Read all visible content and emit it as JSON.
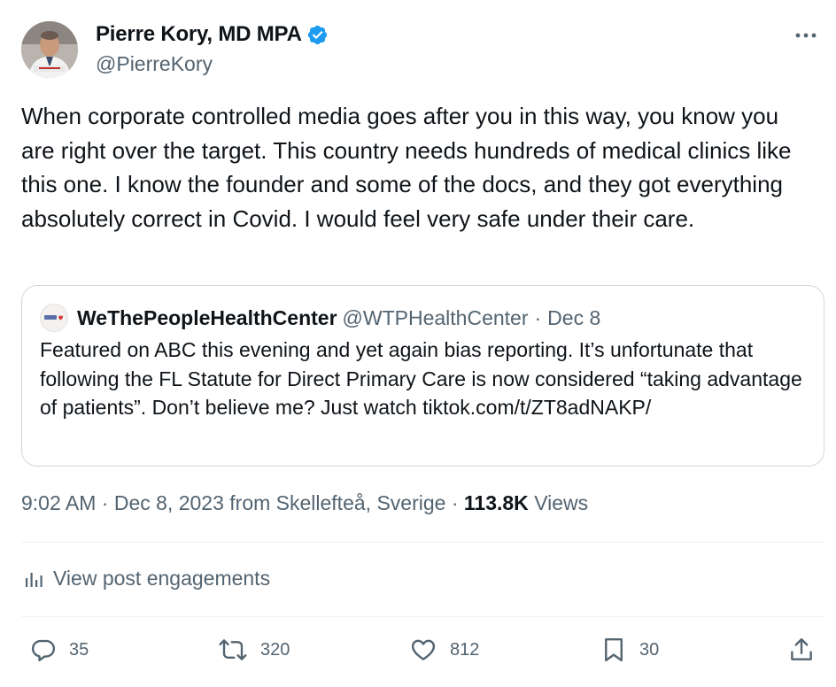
{
  "author": {
    "name": "Pierre Kory, MD MPA",
    "handle": "@PierreKory",
    "verified_color": "#1d9bf0"
  },
  "tweet": {
    "text": "When corporate controlled media goes after you in this way, you know you are right over the target. This country needs hundreds of medical clinics like this one. I know the founder and some of the docs, and they got everything absolutely correct in Covid. I would feel very safe under their care."
  },
  "quote": {
    "name": "WeThePeopleHealthCenter",
    "handle": "@WTPHealthCenter",
    "separator": "·",
    "date": "Dec 8",
    "text": "Featured on ABC this evening and yet again bias reporting. It’s unfortunate that following the FL Statute for Direct Primary Care is now considered “taking advantage of patients”.  Don’t believe me? Just watch tiktok.com/t/ZT8adNAKP/"
  },
  "meta": {
    "time": "9:02 AM",
    "sep1": "·",
    "date": "Dec 8, 2023 from Skellefteå, Sverige",
    "sep2": "·",
    "views_count": "113.8K",
    "views_label": "Views"
  },
  "engagements": {
    "label": "View post engagements"
  },
  "actions": {
    "replies": "35",
    "reposts": "320",
    "likes": "812",
    "bookmarks": "30"
  },
  "icons": {
    "more": "more-icon",
    "verified": "verified-badge-icon",
    "analytics": "analytics-icon",
    "reply": "reply-icon",
    "repost": "repost-icon",
    "like": "heart-icon",
    "bookmark": "bookmark-icon",
    "share": "share-icon"
  },
  "colors": {
    "text_primary": "#0f1419",
    "text_secondary": "#536471",
    "border": "#cfd9de",
    "accent": "#1d9bf0"
  }
}
